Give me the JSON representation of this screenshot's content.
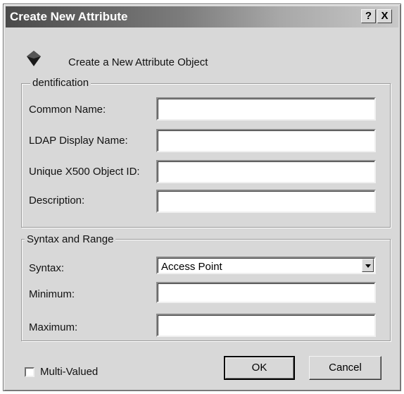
{
  "window": {
    "title": "Create New Attribute",
    "help_label": "?",
    "close_label": "X"
  },
  "header": {
    "icon": "attribute-object-icon",
    "text": "Create a New Attribute Object"
  },
  "identification": {
    "label": "dentification",
    "fields": [
      {
        "label": "Common Name:",
        "value": ""
      },
      {
        "label": "LDAP Display Name:",
        "value": ""
      },
      {
        "label": "Unique X500 Object ID:",
        "value": ""
      },
      {
        "label": "Description:",
        "value": ""
      }
    ]
  },
  "syntax_range": {
    "label": "Syntax and Range",
    "syntax_label": "Syntax:",
    "syntax_value": "Access Point",
    "minimum_label": "Minimum:",
    "minimum_value": "",
    "maximum_label": "Maximum:",
    "maximum_value": ""
  },
  "footer": {
    "multivalued_label": "Multi-Valued",
    "multivalued_checked": false,
    "ok_label": "OK",
    "cancel_label": "Cancel"
  }
}
